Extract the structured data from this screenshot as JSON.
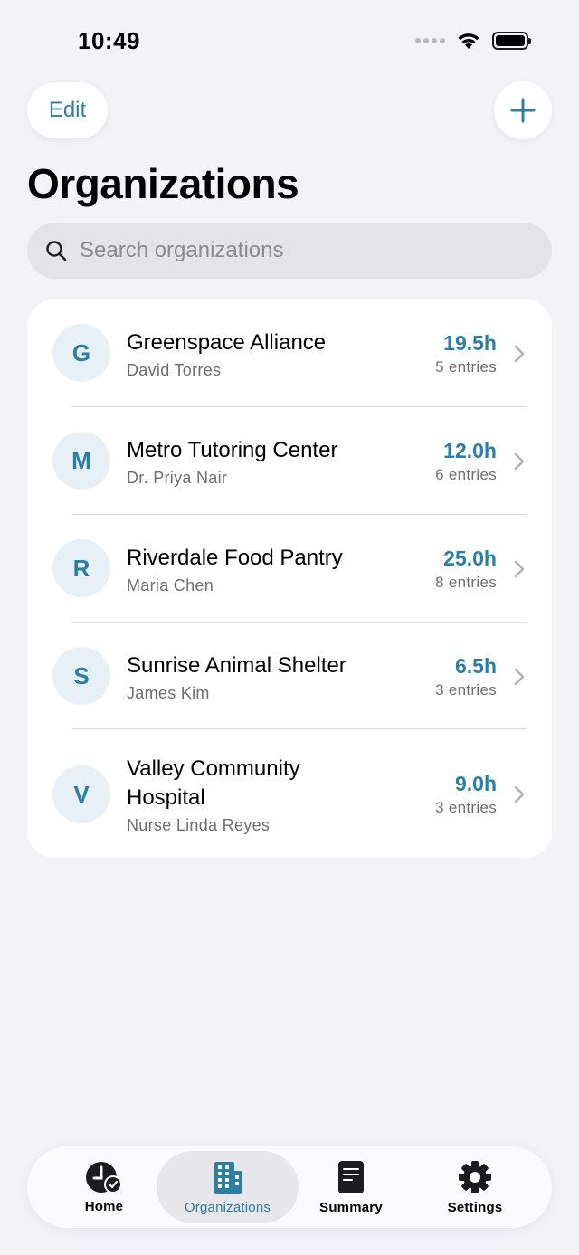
{
  "status_bar": {
    "time": "10:49"
  },
  "nav": {
    "edit_label": "Edit"
  },
  "title": "Organizations",
  "search": {
    "placeholder": "Search organizations",
    "value": ""
  },
  "organizations": [
    {
      "initial": "G",
      "name": "Greenspace Alliance",
      "contact": "David Torres",
      "hours": "19.5h",
      "entries": "5 entries"
    },
    {
      "initial": "M",
      "name": "Metro Tutoring Center",
      "contact": "Dr. Priya Nair",
      "hours": "12.0h",
      "entries": "6 entries"
    },
    {
      "initial": "R",
      "name": "Riverdale Food Pantry",
      "contact": "Maria Chen",
      "hours": "25.0h",
      "entries": "8 entries"
    },
    {
      "initial": "S",
      "name": "Sunrise Animal Shelter",
      "contact": "James Kim",
      "hours": "6.5h",
      "entries": "3 entries"
    },
    {
      "initial": "V",
      "name_line1": "Valley Community",
      "name_line2": "Hospital",
      "contact": "Nurse Linda Reyes",
      "hours": "9.0h",
      "entries": "3 entries"
    }
  ],
  "tabs": [
    {
      "label": "Home",
      "icon": "clock-check-icon"
    },
    {
      "label": "Organizations",
      "icon": "building-icon",
      "active": true
    },
    {
      "label": "Summary",
      "icon": "document-icon"
    },
    {
      "label": "Settings",
      "icon": "gear-icon"
    }
  ],
  "colors": {
    "accent": "#2c7fa4",
    "background": "#f2f2f7",
    "avatar_bg": "#e6f0f6"
  }
}
